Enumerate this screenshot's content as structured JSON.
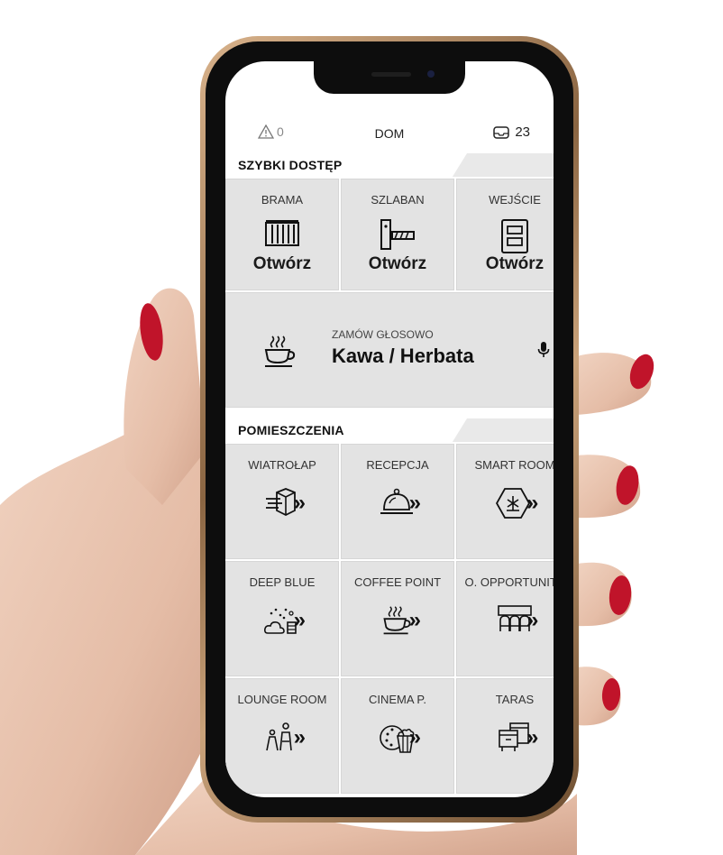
{
  "status": {
    "alert_count": "0",
    "title": "DOM",
    "mail_count": "23"
  },
  "quick_access": {
    "section_label": "SZYBKI DOSTĘP",
    "tiles": [
      {
        "name": "BRAMA",
        "action": "Otwórz",
        "icon": "gate-icon"
      },
      {
        "name": "SZLABAN",
        "action": "Otwórz",
        "icon": "barrier-icon"
      },
      {
        "name": "WEJŚCIE",
        "action": "Otwórz",
        "icon": "door-icon"
      }
    ],
    "voice_order": {
      "sub": "ZAMÓW GŁOSOWO",
      "title": "Kawa / Herbata",
      "icon": "coffee-cup-icon",
      "mic_icon": "microphone-icon"
    }
  },
  "rooms": {
    "section_label": "POMIESZCZENIA",
    "items": [
      {
        "name": "WIATROŁAP",
        "icon": "wind-cube-icon"
      },
      {
        "name": "RECEPCJA",
        "icon": "reception-bell-icon"
      },
      {
        "name": "SMART ROOM",
        "icon": "smart-hexagon-icon"
      },
      {
        "name": "DEEP BLUE",
        "icon": "data-cloud-icon"
      },
      {
        "name": "COFFEE POINT",
        "icon": "coffee-cup-icon"
      },
      {
        "name": "O. OPPORTUNITY",
        "icon": "meeting-chairs-icon"
      },
      {
        "name": "LOUNGE ROOM",
        "icon": "people-icon"
      },
      {
        "name": "CINEMA P.",
        "icon": "popcorn-icon"
      },
      {
        "name": "TARAS",
        "icon": "terrace-furniture-icon"
      }
    ],
    "chevron": "»"
  },
  "colors": {
    "tile_bg": "#e3e3e3",
    "section_bg": "#e9e9e9",
    "phone_frame": "#c9a27a",
    "nail": "#c0142a"
  }
}
